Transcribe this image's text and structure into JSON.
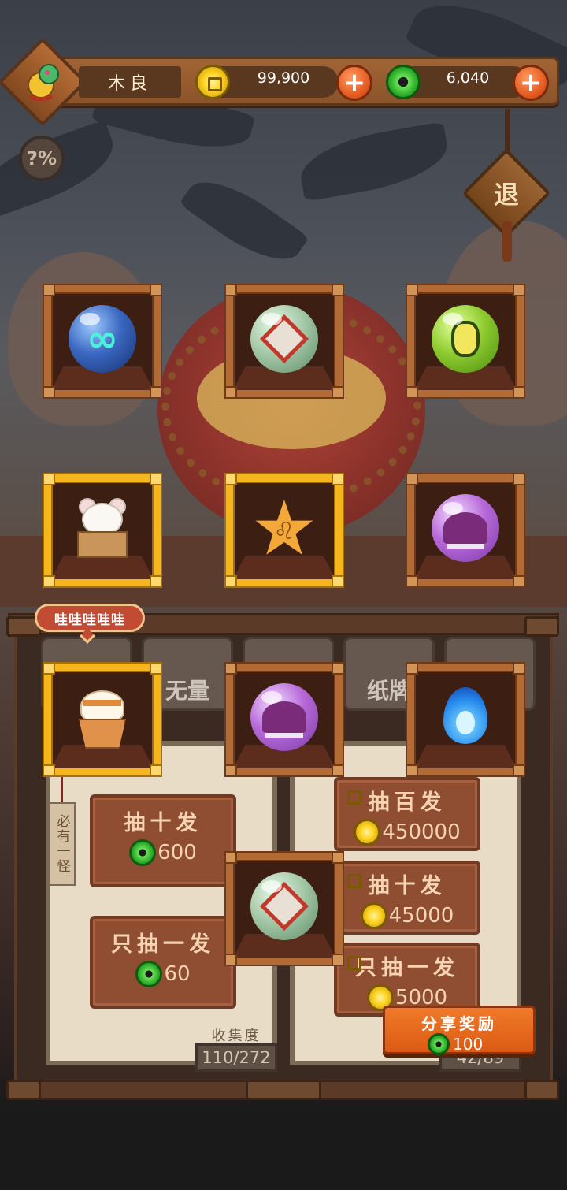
{
  "header": {
    "player_name": "木良",
    "gold_amount": "99,900",
    "jade_amount": "6,040"
  },
  "buttons": {
    "exit_label": "退",
    "help_label": "?%"
  },
  "tabs": [
    {
      "label": ""
    },
    {
      "label": "无量"
    },
    {
      "label": ""
    },
    {
      "label": "纸牌"
    },
    {
      "label": ""
    }
  ],
  "speech_bubble": "哇哇哇哇哇",
  "side_tag": "必有一怪",
  "left_panel": {
    "draw_ten": {
      "label": "抽十发",
      "price": "600",
      "currency": "jade"
    },
    "draw_one": {
      "label": "只抽一发",
      "price": "60",
      "currency": "jade"
    },
    "collection_label": "收集度",
    "collection_value": "110/272"
  },
  "right_panel": {
    "draw_hundred": {
      "label": "抽百发",
      "price": "450000",
      "currency": "gold"
    },
    "draw_ten": {
      "label": "抽十发",
      "price": "45000",
      "currency": "gold"
    },
    "draw_one": {
      "label": "只抽一发",
      "price": "5000",
      "currency": "gold"
    },
    "collection_value": "42/89"
  },
  "share": {
    "label": "分享奖励",
    "amount": "100"
  },
  "rewards": [
    {
      "name": "infinity-orb-icon",
      "rarity": "normal"
    },
    {
      "name": "tile-orb-icon",
      "rarity": "normal"
    },
    {
      "name": "bug-orb-icon",
      "rarity": "normal"
    },
    {
      "name": "mouse-in-box-icon",
      "rarity": "rare"
    },
    {
      "name": "leo-star-icon",
      "rarity": "rare"
    },
    {
      "name": "purple-orb-icon",
      "rarity": "normal"
    },
    {
      "name": "muffin-icon",
      "rarity": "rare"
    },
    {
      "name": "purple-orb-icon",
      "rarity": "normal"
    },
    {
      "name": "blue-flame-icon",
      "rarity": "normal"
    },
    {
      "name": "tile-orb-icon",
      "rarity": "normal"
    }
  ],
  "colors": {
    "gold_frame": "#f5b51c",
    "wood_frame": "#b36b35",
    "accent_orange": "#e0531b",
    "jade_green": "#2fb02c",
    "gold_coin": "#ffd628"
  }
}
